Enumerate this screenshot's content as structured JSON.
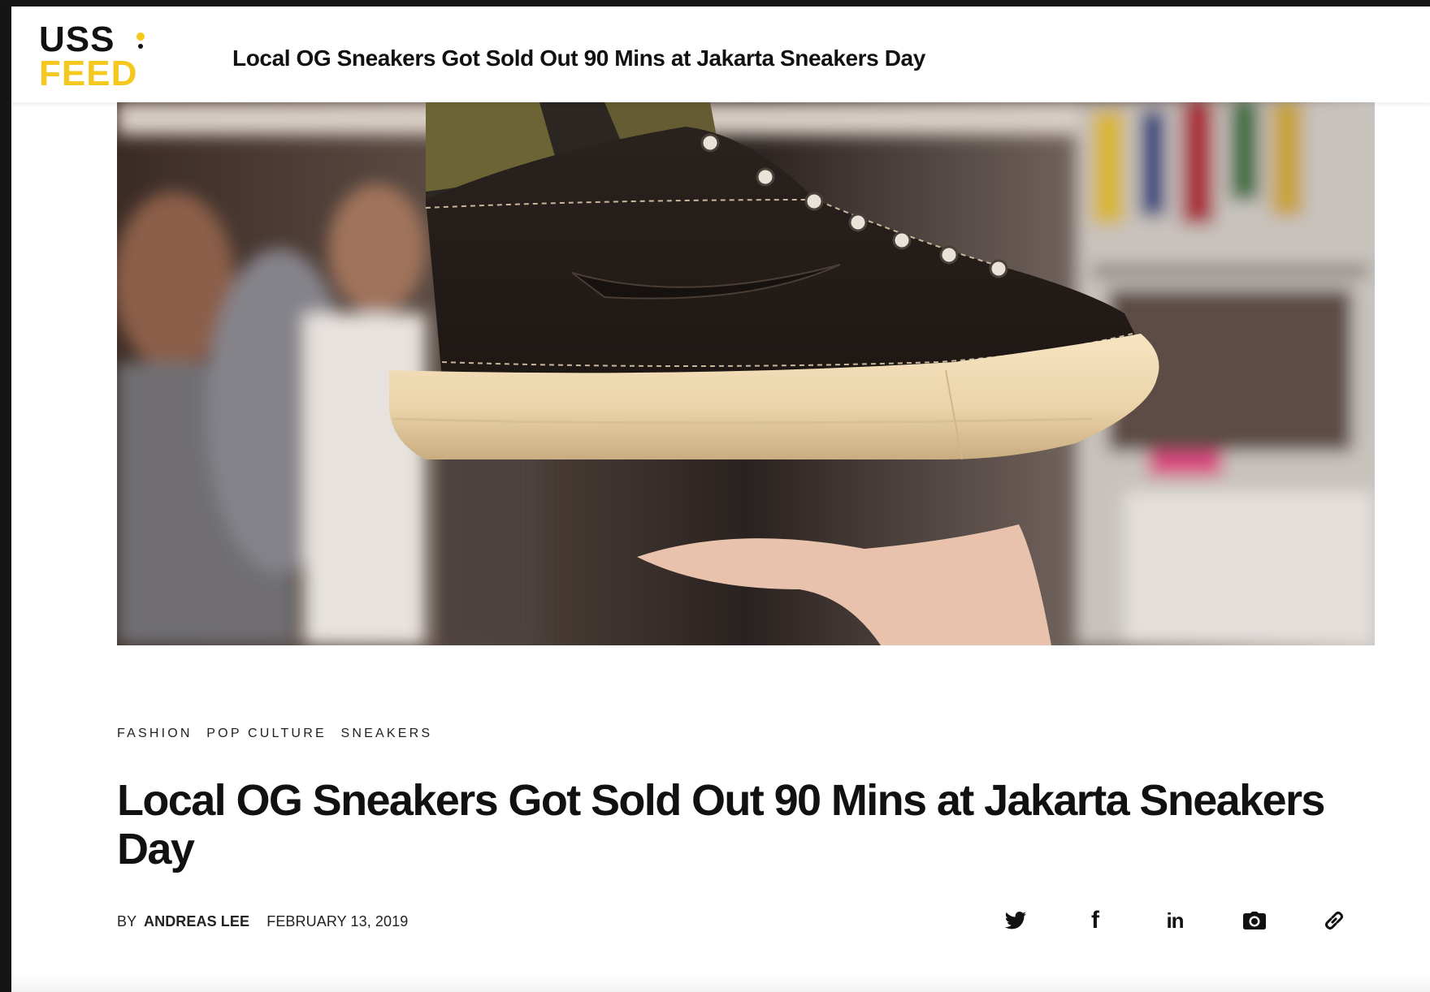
{
  "header": {
    "logo_top": "USS",
    "logo_bottom": "FEED",
    "title": "Local OG Sneakers Got Sold Out 90 Mins at Jakarta Sneakers Day"
  },
  "hero": {
    "icon": "hero-image-sneaker"
  },
  "article": {
    "categories": [
      "FASHION",
      "POP CULTURE",
      "SNEAKERS"
    ],
    "title": "Local OG Sneakers Got Sold Out 90 Mins at Jakarta Sneakers Day",
    "byline_prefix": "BY",
    "author": "ANDREAS LEE",
    "date": "FEBRUARY 13, 2019"
  },
  "share": {
    "facebook_glyph": "f",
    "linkedin_glyph": "in",
    "icons": [
      "twitter-icon",
      "facebook-icon",
      "linkedin-icon",
      "camera-icon",
      "link-icon"
    ]
  },
  "colors": {
    "brand_yellow": "#f4c81c",
    "text": "#111111",
    "background": "#ffffff"
  }
}
